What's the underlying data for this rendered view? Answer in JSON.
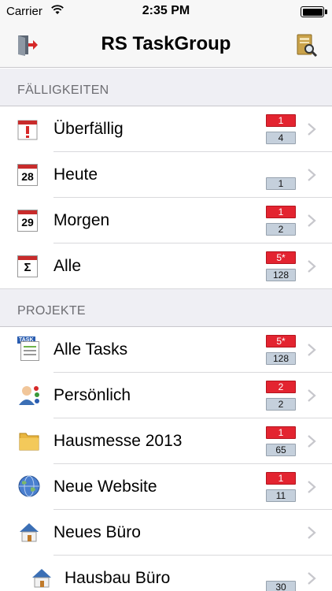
{
  "status": {
    "carrier": "Carrier",
    "time": "2:35 PM"
  },
  "nav": {
    "title": "RS TaskGroup",
    "left_icon": "exit-door-icon",
    "right_icon": "book-search-icon"
  },
  "sections": {
    "due": "FÄLLIGKEITEN",
    "projects": "PROJEKTE"
  },
  "due_rows": [
    {
      "label": "Überfällig",
      "icon": "overdue-calendar-icon",
      "red": "1",
      "grey": "4"
    },
    {
      "label": "Heute",
      "icon": "calendar-28-icon",
      "red": "",
      "grey": "1",
      "icon_text": "28"
    },
    {
      "label": "Morgen",
      "icon": "calendar-29-icon",
      "red": "1",
      "grey": "2",
      "icon_text": "29"
    },
    {
      "label": "Alle",
      "icon": "calendar-sum-icon",
      "red": "5*",
      "grey": "128",
      "icon_text": "Σ"
    }
  ],
  "project_rows": [
    {
      "label": "Alle Tasks",
      "icon": "task-list-icon",
      "red": "5*",
      "grey": "128",
      "icon_text": "TASK"
    },
    {
      "label": "Persönlich",
      "icon": "person-icon",
      "red": "2",
      "grey": "2"
    },
    {
      "label": "Hausmesse 2013",
      "icon": "folder-icon",
      "red": "1",
      "grey": "65"
    },
    {
      "label": "Neue Website",
      "icon": "globe-icon",
      "red": "1",
      "grey": "11"
    },
    {
      "label": "Neues Büro",
      "icon": "house-icon",
      "red": "",
      "grey": ""
    },
    {
      "label": "Hausbau Büro",
      "icon": "house-icon",
      "red": "",
      "grey": "30"
    }
  ],
  "colors": {
    "badge_red": "#e32430",
    "badge_grey": "#c5d0dc",
    "section_bg": "#efeff4"
  }
}
